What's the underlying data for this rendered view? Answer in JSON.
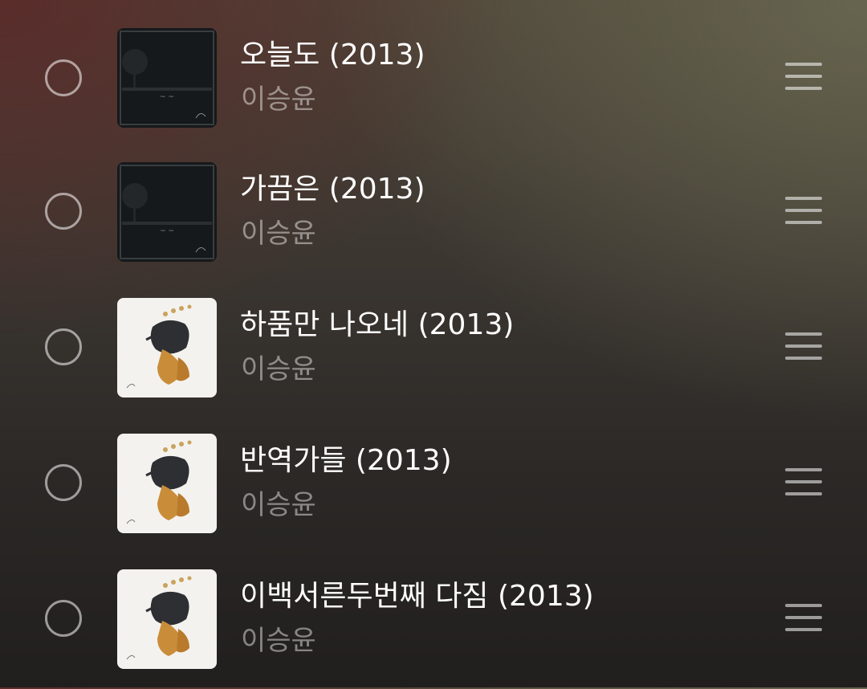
{
  "tracks": [
    {
      "title": "오늘도 (2013)",
      "artist": "이승윤",
      "cover": "dark-field-cover"
    },
    {
      "title": "가끔은 (2013)",
      "artist": "이승윤",
      "cover": "dark-field-cover"
    },
    {
      "title": "하품만 나오네 (2013)",
      "artist": "이승윤",
      "cover": "white-illustration-cover"
    },
    {
      "title": "반역가들 (2013)",
      "artist": "이승윤",
      "cover": "white-illustration-cover"
    },
    {
      "title": "이백서른두번째 다짐 (2013)",
      "artist": "이승윤",
      "cover": "white-illustration-cover"
    }
  ]
}
